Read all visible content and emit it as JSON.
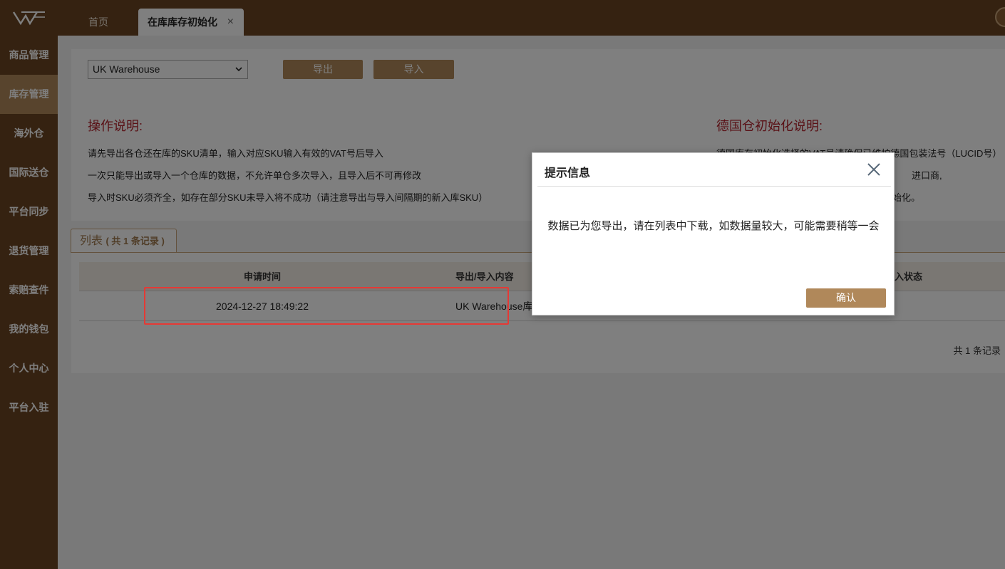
{
  "header": {
    "tabs": [
      {
        "label": "首页"
      },
      {
        "label": "在库库存初始化"
      }
    ],
    "close_glyph": "×"
  },
  "sidebar": {
    "items": [
      {
        "label": "商品管理"
      },
      {
        "label": "库存管理"
      },
      {
        "label": "海外仓"
      },
      {
        "label": "国际送仓"
      },
      {
        "label": "平台同步"
      },
      {
        "label": "退货管理"
      },
      {
        "label": "索赔查件"
      },
      {
        "label": "我的钱包"
      },
      {
        "label": "个人中心"
      },
      {
        "label": "平台入驻"
      }
    ],
    "active_index": 1
  },
  "toolbar": {
    "warehouse_value": "UK Warehouse",
    "export_label": "导出",
    "import_label": "导入"
  },
  "instructions": {
    "title": "操作说明:",
    "lines": [
      "请先导出各仓还在库的SKU清单，输入对应SKU输入有效的VAT号后导入",
      "一次只能导出或导入一个仓库的数据，不允许单仓多次导入，且导入后不可再修改",
      "导入时SKU必须齐全，如存在部分SKU未导入将不成功（请注意导出与导入间隔期的新入库SKU）"
    ]
  },
  "germany": {
    "title": "德国仓初始化说明:",
    "lines": [
      "德国库存初始化选择的VAT号请确保已维护德国包装法号（LUCID号）",
      "进口商,",
      "始化。"
    ]
  },
  "list": {
    "tab_label": "列表",
    "count_text": "( 共 1 条记录 )",
    "columns": {
      "time": "申请时间",
      "content": "导出/导入内容",
      "status": "入状态"
    },
    "rows": [
      {
        "time": "2024-12-27 18:49:22",
        "content": "UK Warehouse库"
      }
    ],
    "total_text": "共 1 条记录"
  },
  "modal": {
    "title": "提示信息",
    "message": "数据已为您导出，请在列表中下载，如数据量较大，可能需要稍等一会",
    "confirm_label": "确认"
  },
  "colors": {
    "brand_dark": "#6b4522",
    "brand_light": "#b0885a",
    "title_red": "#b3202a",
    "highlight_red": "#e53935"
  }
}
